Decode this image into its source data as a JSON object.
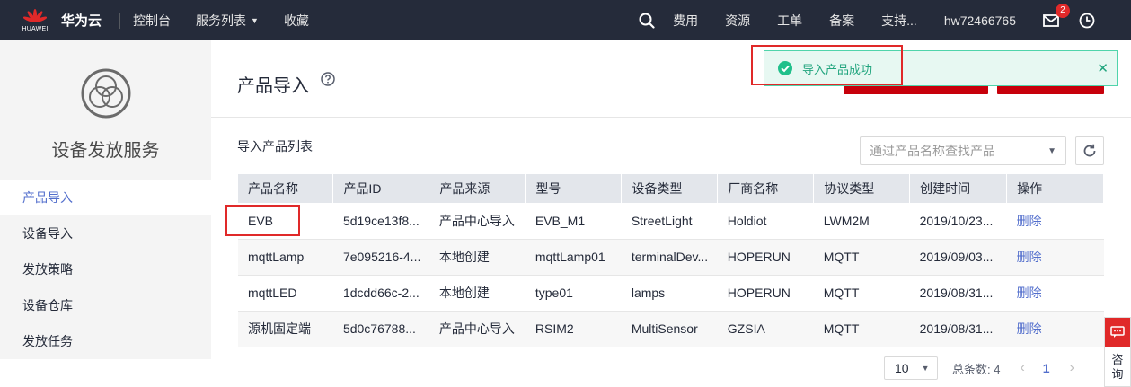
{
  "topbar": {
    "logo_text": "HUAWEI",
    "brand": "华为云",
    "nav": [
      "控制台",
      "服务列表",
      "收藏"
    ],
    "right_links": [
      "费用",
      "资源",
      "工单",
      "备案",
      "支持..."
    ],
    "username": "hw72466765",
    "mail_badge": "2"
  },
  "sidebar": {
    "title": "设备发放服务",
    "items": [
      {
        "label": "产品导入",
        "active": true
      },
      {
        "label": "设备导入",
        "active": false
      },
      {
        "label": "发放策略",
        "active": false
      },
      {
        "label": "设备仓库",
        "active": false
      },
      {
        "label": "发放任务",
        "active": false
      }
    ]
  },
  "main": {
    "title": "产品导入",
    "list_title": "导入产品列表",
    "search_placeholder": "通过产品名称查找产品",
    "toast": "导入产品成功",
    "columns": [
      "产品名称",
      "产品ID",
      "产品来源",
      "型号",
      "设备类型",
      "厂商名称",
      "协议类型",
      "创建时间",
      "操作"
    ],
    "rows": [
      [
        "EVB",
        "5d19ce13f8...",
        "产品中心导入",
        "EVB_M1",
        "StreetLight",
        "Holdiot",
        "LWM2M",
        "2019/10/23...",
        "删除"
      ],
      [
        "mqttLamp",
        "7e095216-4...",
        "本地创建",
        "mqttLamp01",
        "terminalDev...",
        "HOPERUN",
        "MQTT",
        "2019/09/03...",
        "删除"
      ],
      [
        "mqttLED",
        "1dcdd66c-2...",
        "本地创建",
        "type01",
        "lamps",
        "HOPERUN",
        "MQTT",
        "2019/08/31...",
        "删除"
      ],
      [
        "源机固定端",
        "5d0c76788...",
        "产品中心导入",
        "RSIM2",
        "MultiSensor",
        "GZSIA",
        "MQTT",
        "2019/08/31...",
        "删除"
      ]
    ],
    "pagination": {
      "page_size": "10",
      "total": "总条数: 4",
      "current_page": "1"
    }
  },
  "consult": {
    "label": "咨询"
  },
  "colors": {
    "topbar": "#252b3a",
    "accent_red": "#c7000b",
    "link_blue": "#526ecc",
    "success_green": "#21a57e"
  }
}
